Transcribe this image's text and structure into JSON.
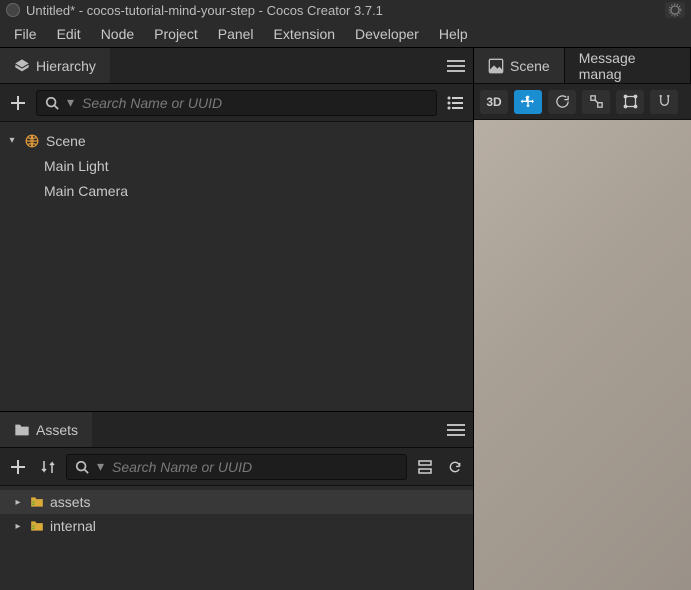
{
  "window": {
    "title": "Untitled* - cocos-tutorial-mind-your-step - Cocos Creator 3.7.1"
  },
  "menubar": {
    "items": [
      "File",
      "Edit",
      "Node",
      "Project",
      "Panel",
      "Extension",
      "Developer",
      "Help"
    ]
  },
  "hierarchy": {
    "tab_label": "Hierarchy",
    "search_placeholder": "Search Name or UUID",
    "root_label": "Scene",
    "children": [
      "Main Light",
      "Main Camera"
    ]
  },
  "assets": {
    "tab_label": "Assets",
    "search_placeholder": "Search Name or UUID",
    "folders": [
      "assets",
      "internal"
    ]
  },
  "scene": {
    "tab_label": "Scene",
    "secondary_tab_label": "Message manag",
    "toolbar": {
      "mode3d": "3D"
    }
  }
}
